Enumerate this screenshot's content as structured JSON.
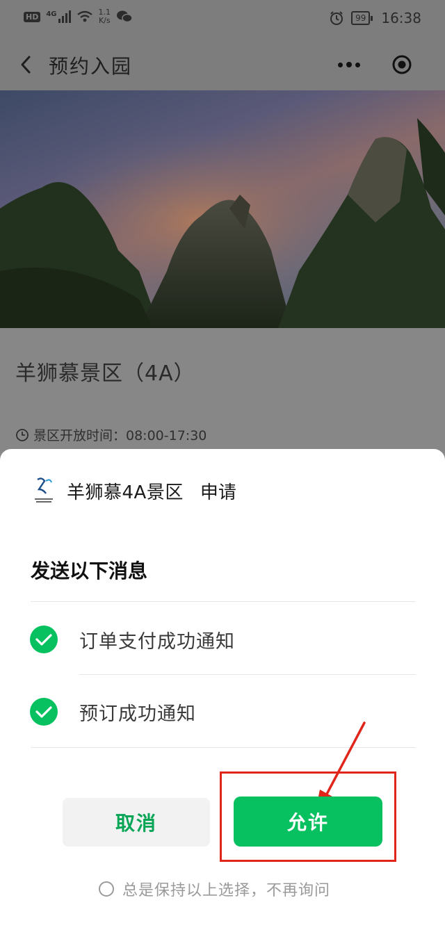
{
  "status_bar": {
    "network": "HD",
    "signal": "4G",
    "speed_value": "1.1",
    "speed_unit": "K/s",
    "battery": "99",
    "time": "16:38"
  },
  "nav": {
    "title": "预约入园"
  },
  "page": {
    "scenic_title": "羊狮慕景区（4A）",
    "hours_label": "景区开放时间：08:00-17:30"
  },
  "sheet": {
    "app_name": "羊狮慕4A景区",
    "app_action": "申请",
    "send_title": "发送以下消息",
    "messages": [
      {
        "label": "订单支付成功通知",
        "checked": true
      },
      {
        "label": "预订成功通知",
        "checked": true
      }
    ],
    "cancel_label": "取消",
    "allow_label": "允许",
    "remember_label": "总是保持以上选择，不再询问"
  },
  "colors": {
    "accent_green": "#07c160",
    "annotation_red": "#e0251b"
  }
}
